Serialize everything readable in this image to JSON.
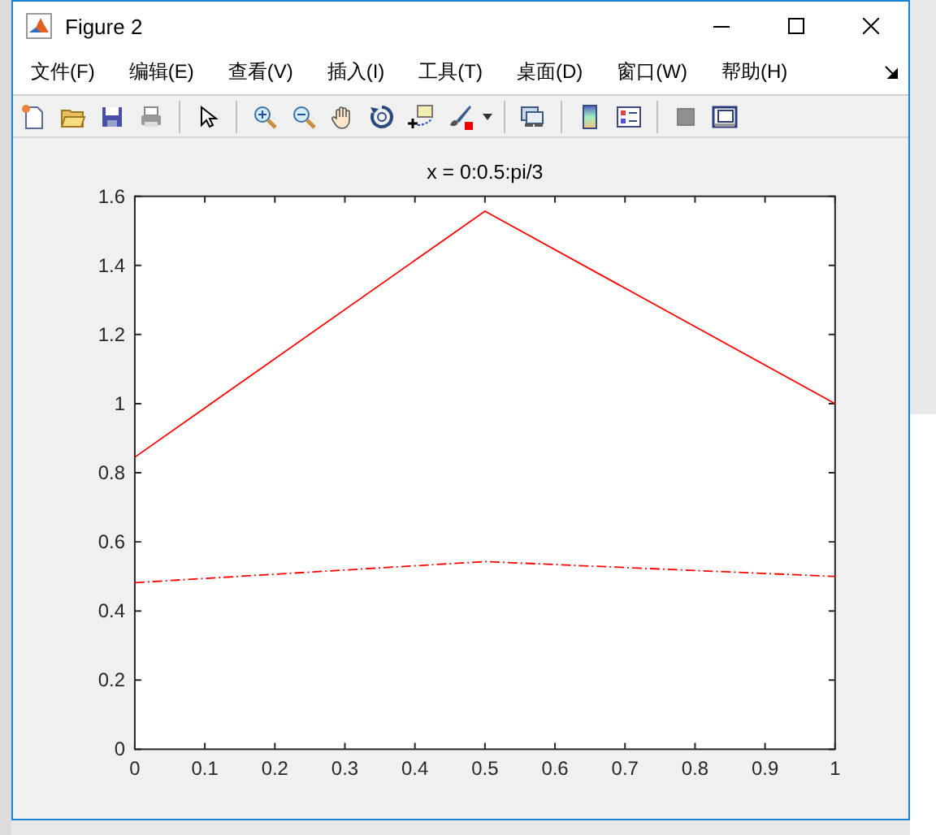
{
  "window": {
    "title": "Figure 2"
  },
  "menu": [
    {
      "label": "文件(F)"
    },
    {
      "label": "编辑(E)"
    },
    {
      "label": "查看(V)"
    },
    {
      "label": "插入(I)"
    },
    {
      "label": "工具(T)"
    },
    {
      "label": "桌面(D)"
    },
    {
      "label": "窗口(W)"
    },
    {
      "label": "帮助(H)"
    }
  ],
  "figure": {
    "chart_data": {
      "type": "line",
      "title": "x = 0:0.5:pi/3",
      "x": [
        0,
        0.5,
        1
      ],
      "xlim": [
        0,
        1
      ],
      "ylim": [
        0,
        1.6
      ],
      "xticks": [
        0,
        0.1,
        0.2,
        0.3,
        0.4,
        0.5,
        0.6,
        0.7,
        0.8,
        0.9,
        1
      ],
      "yticks": [
        0,
        0.2,
        0.4,
        0.6,
        0.8,
        1,
        1.2,
        1.4,
        1.6
      ],
      "series": [
        {
          "color": "#ff0000",
          "line_style": "solid",
          "values": [
            0.845,
            1.557,
            1.0
          ]
        },
        {
          "color": "#ff0000",
          "line_style": "dashdot",
          "values": [
            0.482,
            0.543,
            0.5
          ]
        }
      ]
    }
  }
}
